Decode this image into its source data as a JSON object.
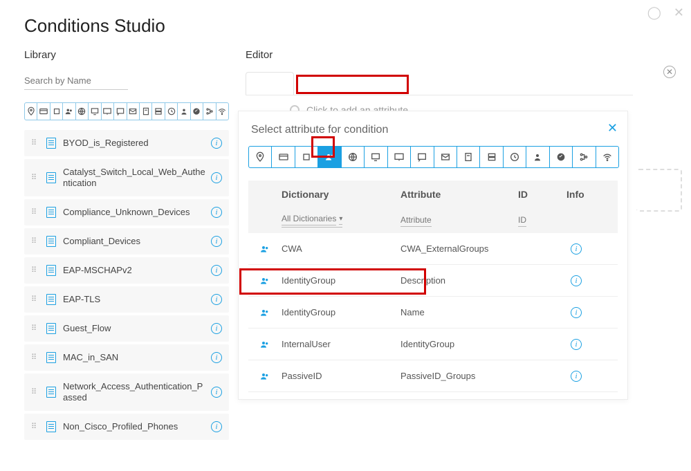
{
  "page_title": "Conditions Studio",
  "library": {
    "label": "Library",
    "search_placeholder": "Search by Name",
    "items": [
      {
        "label": "BYOD_is_Registered"
      },
      {
        "label": "Catalyst_Switch_Local_Web_Authentication"
      },
      {
        "label": "Compliance_Unknown_Devices"
      },
      {
        "label": "Compliant_Devices"
      },
      {
        "label": "EAP-MSCHAPv2"
      },
      {
        "label": "EAP-TLS"
      },
      {
        "label": "Guest_Flow"
      },
      {
        "label": "MAC_in_SAN"
      },
      {
        "label": "Network_Access_Authentication_Passed"
      },
      {
        "label": "Non_Cisco_Profiled_Phones"
      }
    ]
  },
  "editor": {
    "label": "Editor",
    "attr_placeholder": "Click to add an attribute"
  },
  "popup": {
    "title": "Select attribute for condition",
    "headers": {
      "dictionary": "Dictionary",
      "attribute": "Attribute",
      "id": "ID",
      "info": "Info"
    },
    "filter": {
      "dictionary": "All Dictionaries",
      "attribute": "Attribute",
      "id": "ID"
    },
    "rows": [
      {
        "dictionary": "CWA",
        "attribute": "CWA_ExternalGroups"
      },
      {
        "dictionary": "IdentityGroup",
        "attribute": "Description"
      },
      {
        "dictionary": "IdentityGroup",
        "attribute": "Name"
      },
      {
        "dictionary": "InternalUser",
        "attribute": "IdentityGroup"
      },
      {
        "dictionary": "PassiveID",
        "attribute": "PassiveID_Groups"
      }
    ]
  }
}
